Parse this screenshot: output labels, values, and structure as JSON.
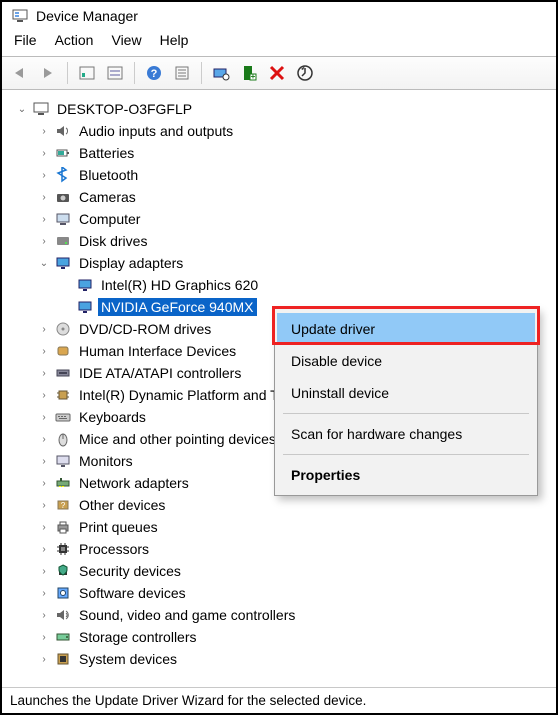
{
  "window": {
    "title": "Device Manager"
  },
  "menu": {
    "file": "File",
    "action": "Action",
    "view": "View",
    "help": "Help"
  },
  "tree": {
    "root": {
      "name": "DESKTOP-O3FGFLP"
    },
    "items": [
      {
        "label": "Audio inputs and outputs",
        "icon": "speaker"
      },
      {
        "label": "Batteries",
        "icon": "battery"
      },
      {
        "label": "Bluetooth",
        "icon": "bluetooth"
      },
      {
        "label": "Cameras",
        "icon": "camera"
      },
      {
        "label": "Computer",
        "icon": "computer"
      },
      {
        "label": "Disk drives",
        "icon": "disk"
      },
      {
        "label": "Display adapters",
        "icon": "display",
        "expanded": true,
        "children": [
          {
            "label": "Intel(R) HD Graphics 620",
            "icon": "display"
          },
          {
            "label": "NVIDIA GeForce 940MX",
            "icon": "display",
            "selected": true
          }
        ]
      },
      {
        "label": "DVD/CD-ROM drives",
        "icon": "dvd"
      },
      {
        "label": "Human Interface Devices",
        "icon": "hid"
      },
      {
        "label": "IDE ATA/ATAPI controllers",
        "icon": "ide"
      },
      {
        "label": "Intel(R) Dynamic Platform and Thermal Framework",
        "icon": "chip"
      },
      {
        "label": "Keyboards",
        "icon": "keyboard"
      },
      {
        "label": "Mice and other pointing devices",
        "icon": "mouse"
      },
      {
        "label": "Monitors",
        "icon": "monitor"
      },
      {
        "label": "Network adapters",
        "icon": "network"
      },
      {
        "label": "Other devices",
        "icon": "other"
      },
      {
        "label": "Print queues",
        "icon": "printer"
      },
      {
        "label": "Processors",
        "icon": "cpu"
      },
      {
        "label": "Security devices",
        "icon": "security"
      },
      {
        "label": "Software devices",
        "icon": "software"
      },
      {
        "label": "Sound, video and game controllers",
        "icon": "sound"
      },
      {
        "label": "Storage controllers",
        "icon": "storage"
      },
      {
        "label": "System devices",
        "icon": "system"
      }
    ]
  },
  "context_menu": {
    "update": "Update driver",
    "disable": "Disable device",
    "uninstall": "Uninstall device",
    "scan": "Scan for hardware changes",
    "properties": "Properties"
  },
  "statusbar": {
    "text": "Launches the Update Driver Wizard for the selected device."
  }
}
